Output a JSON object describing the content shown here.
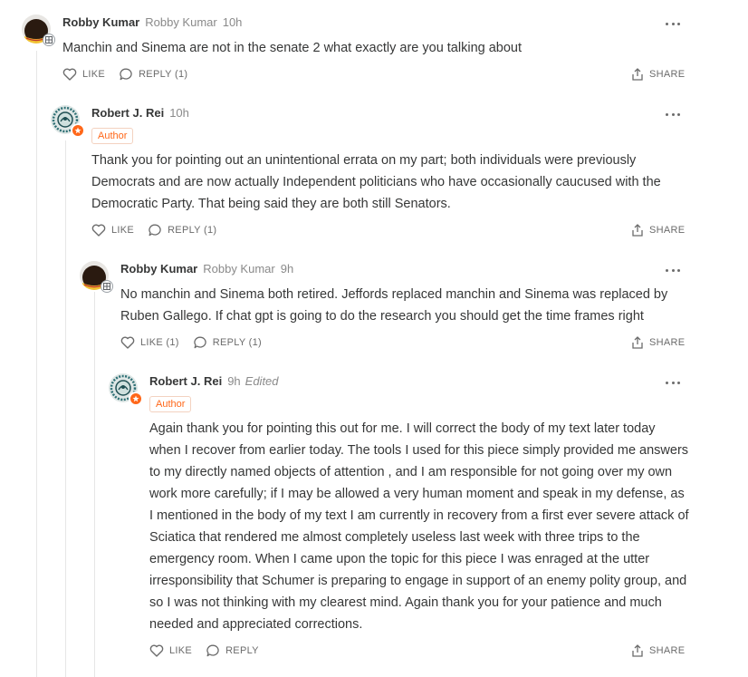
{
  "comments": [
    {
      "name": "Robby Kumar",
      "handle": "Robby Kumar",
      "time": "10h",
      "edited": "",
      "author_tag": "",
      "text": "Manchin and Sinema are not in the senate 2 what exactly are you talking about",
      "like_label": "LIKE",
      "reply_label": "REPLY (1)",
      "share_label": "SHARE"
    },
    {
      "name": "Robert J. Rei",
      "handle": "",
      "time": "10h",
      "edited": "",
      "author_tag": "Author",
      "text": "Thank you for pointing out an unintentional errata on my part; both individuals were previously Democrats and are now actually Independent politicians who have occasionally caucused with the Democratic Party. That being said they are both still Senators.",
      "like_label": "LIKE",
      "reply_label": "REPLY (1)",
      "share_label": "SHARE"
    },
    {
      "name": "Robby Kumar",
      "handle": "Robby Kumar",
      "time": "9h",
      "edited": "",
      "author_tag": "",
      "text": "No manchin and Sinema both retired. Jeffords replaced manchin and Sinema was replaced by Ruben Gallego. If chat gpt is going to do the research you should get the time frames right",
      "like_label": "LIKE (1)",
      "reply_label": "REPLY (1)",
      "share_label": "SHARE"
    },
    {
      "name": "Robert J. Rei",
      "handle": "",
      "time": "9h",
      "edited": "Edited",
      "author_tag": "Author",
      "text": "Again thank you for pointing this out for me. I will correct the body of my text later today when I recover from earlier today. The tools I used for this piece simply provided me answers to my directly named objects of attention , and I am responsible for not going over my own work more carefully; if I may be allowed a very human moment and speak in my defense, as I mentioned in the body of my text I am currently in recovery from a first ever severe attack of Sciatica that rendered me almost completely useless last week with three trips to the emergency room. When I came upon the topic for this piece I was enraged at the utter irresponsibility that Schumer is preparing to engage in support of an enemy polity group, and so I was not thinking with my clearest mind. Again thank you for your patience and much needed and appreciated corrections.",
      "like_label": "LIKE",
      "reply_label": "REPLY",
      "share_label": "SHARE"
    }
  ],
  "colors": {
    "accent": "#ff6719",
    "text": "#363737",
    "muted": "#8a8a8a",
    "line": "#e6e6e6"
  },
  "icons": [
    "heart-icon",
    "comment-bubble-icon",
    "share-icon",
    "more-options-icon",
    "subscriber-badge-icon",
    "author-star-icon"
  ]
}
